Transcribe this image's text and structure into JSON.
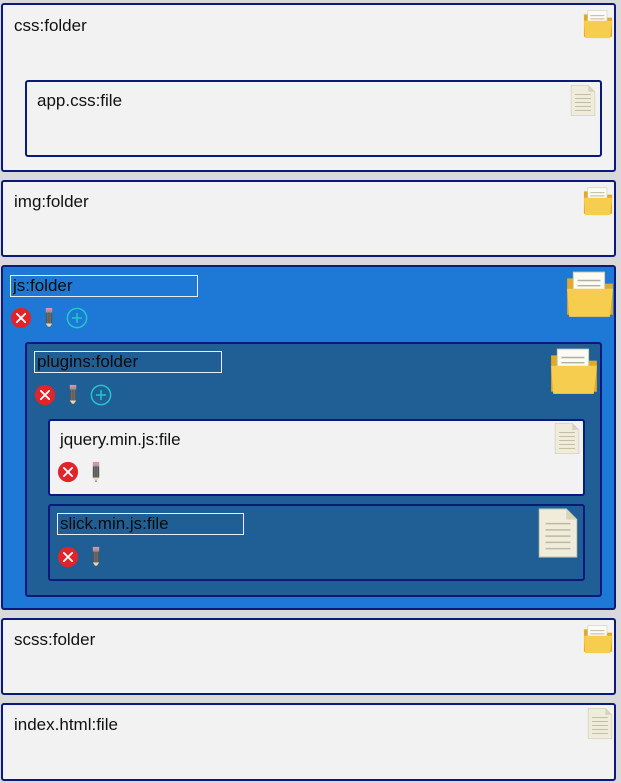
{
  "tree": {
    "css": {
      "label": "css:folder"
    },
    "app_css": {
      "label": "app.css:file"
    },
    "img": {
      "label": "img:folder"
    },
    "js": {
      "value": "js:folder"
    },
    "plugins": {
      "value": "plugins:folder"
    },
    "jquery": {
      "label": "jquery.min.js:file"
    },
    "slick": {
      "value": "slick.min.js:file"
    },
    "scss": {
      "label": "scss:folder"
    },
    "index": {
      "label": "index.html:file"
    }
  },
  "icons": {
    "folder": "folder-icon",
    "file": "file-icon",
    "delete": "delete-icon",
    "rename": "pencil-icon",
    "add": "add-icon"
  },
  "colors": {
    "panel": "#f2f2f2",
    "border": "#0b1a7a",
    "selected_outer": "#1e79d6",
    "selected_inner": "#1f5f96",
    "delete": "#e0242a",
    "add": "#20c9c9",
    "folder": "#f4c84a"
  }
}
